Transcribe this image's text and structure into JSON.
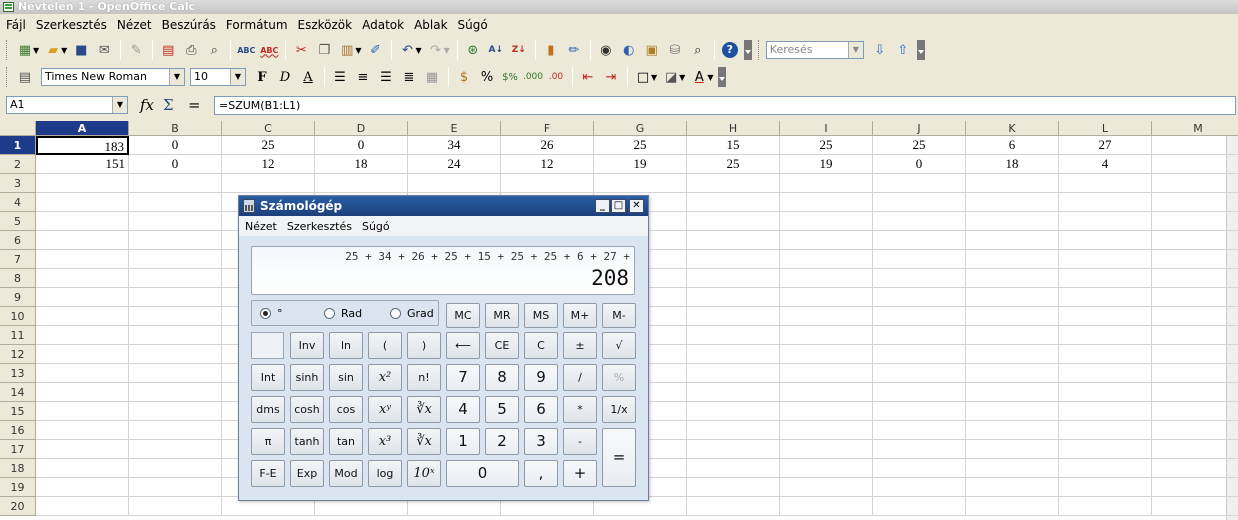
{
  "window": {
    "title": "Névtelen 1 - OpenOffice Calc"
  },
  "menu": [
    "Fájl",
    "Szerkesztés",
    "Nézet",
    "Beszúrás",
    "Formátum",
    "Eszközök",
    "Adatok",
    "Ablak",
    "Súgó"
  ],
  "toolbar1": {
    "icons": [
      "new-icon",
      "open-icon",
      "save-icon",
      "email-icon",
      "edit-file-icon",
      "export-pdf-icon",
      "print-icon",
      "page-preview-icon",
      "spellcheck-icon",
      "autospellcheck-icon",
      "cut-icon",
      "copy-icon",
      "paste-icon",
      "format-paintbrush-icon",
      "undo-icon",
      "redo-icon",
      "hyperlink-icon",
      "sort-ascending-icon",
      "sort-descending-icon",
      "chart-icon",
      "draw-functions-icon",
      "navigator-icon",
      "gallery-icon",
      "data-sources-icon",
      "zoom-icon",
      "help-icon"
    ],
    "search_placeholder": "Keresés"
  },
  "toolbar2": {
    "font_name": "Times New Roman",
    "font_size": "10",
    "bold": "F",
    "italic": "D",
    "underline": "A"
  },
  "formula_bar": {
    "cell_ref": "A1",
    "formula": "=SZUM(B1:L1)"
  },
  "sheet": {
    "columns": [
      "A",
      "B",
      "C",
      "D",
      "E",
      "F",
      "G",
      "H",
      "I",
      "J",
      "K",
      "L",
      "M"
    ],
    "rows": [
      "1",
      "2",
      "3",
      "4",
      "5",
      "6",
      "7",
      "8",
      "9",
      "10",
      "11",
      "12",
      "13",
      "14",
      "15",
      "16",
      "17",
      "18",
      "19",
      "20"
    ],
    "data": [
      [
        "183",
        "0",
        "25",
        "0",
        "34",
        "26",
        "25",
        "15",
        "25",
        "25",
        "6",
        "27"
      ],
      [
        "151",
        "0",
        "12",
        "18",
        "24",
        "12",
        "19",
        "25",
        "19",
        "0",
        "18",
        "4"
      ]
    ]
  },
  "calculator": {
    "title": "Számológép",
    "menu": [
      "Nézet",
      "Szerkesztés",
      "Súgó"
    ],
    "expression": "25 + 34 + 26 + 25 + 15 + 25 + 25 + 6 + 27 +",
    "result": "208",
    "angle_modes": [
      "°",
      "Rad",
      "Grad"
    ],
    "memory": [
      "MC",
      "MR",
      "MS",
      "M+",
      "M-"
    ],
    "row2": [
      "Inv",
      "ln",
      "(",
      ")",
      "⟵",
      "CE",
      "C",
      "±",
      "√"
    ],
    "row3": [
      "Int",
      "sinh",
      "sin",
      "x²",
      "n!",
      "7",
      "8",
      "9",
      "/",
      "%"
    ],
    "row4": [
      "dms",
      "cosh",
      "cos",
      "xʸ",
      "∛x",
      "4",
      "5",
      "6",
      "*",
      "1/x"
    ],
    "row5": [
      "π",
      "tanh",
      "tan",
      "x³",
      "∛x",
      "1",
      "2",
      "3",
      "-",
      "="
    ],
    "row6": [
      "F-E",
      "Exp",
      "Mod",
      "log",
      "10ˣ",
      "0",
      ",",
      "+"
    ]
  }
}
